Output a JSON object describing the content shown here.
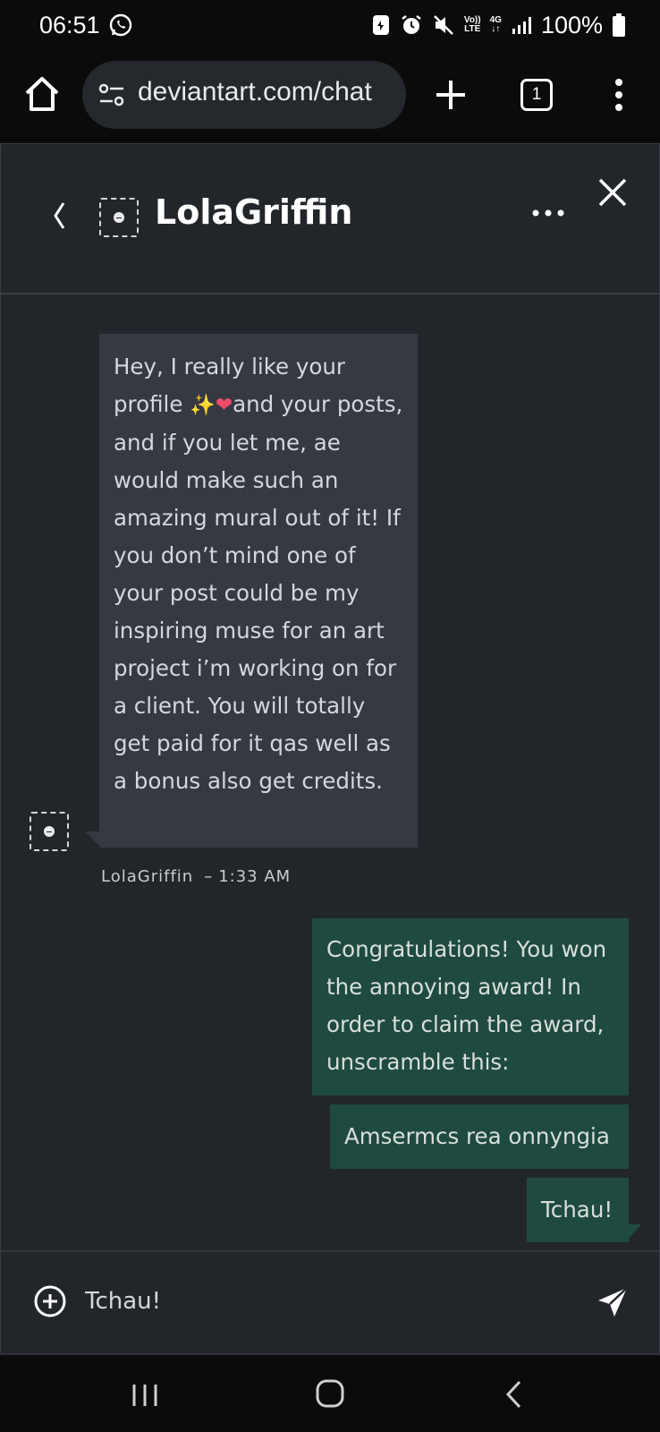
{
  "status_bar": {
    "time": "06:51",
    "battery": "100%",
    "network": "4G",
    "volte": "Vo))",
    "lte": "LTE"
  },
  "browser": {
    "url": "deviantart.com/chat",
    "tab_count": "1"
  },
  "chat": {
    "contact_name": "LolaGriffin",
    "messages_incoming": [
      {
        "text_before_emoji": "Hey, I really like your profile ",
        "emoji_sparkle": "✨",
        "emoji_heart": "❤",
        "text_after_emoji": "and your posts, and if you let me, ae would make such an amazing mural out of it! If you don’t mind one of your post could be my inspiring muse for an art project i’m working on for a client. You will totally get paid for it qas well as a bonus also get credits.",
        "sender": "LolaGriffin",
        "time": "1:33 AM"
      }
    ],
    "messages_outgoing": [
      {
        "text": "Congratulations! You won the annoying award! In order to claim the award, unscramble this:"
      },
      {
        "text": "Amsermcs rea onnyngia"
      },
      {
        "text": "Tchau!"
      }
    ],
    "compose_value": "Tchau!"
  },
  "colors": {
    "chat_background": "#22262b",
    "incoming_bubble": "#353942",
    "outgoing_bubble": "#1f4a3f"
  }
}
